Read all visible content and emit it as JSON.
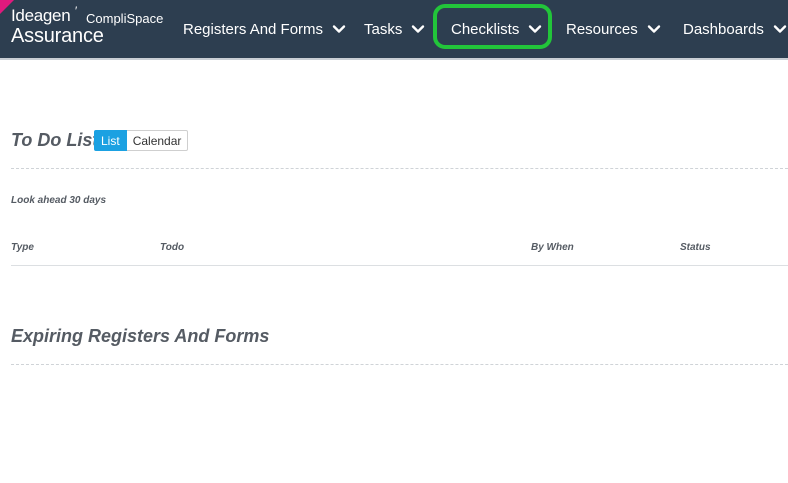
{
  "header": {
    "brand": "Ideagen",
    "product": "CompliSpace",
    "sub": "Assurance",
    "nav": [
      {
        "label": "Registers And Forms"
      },
      {
        "label": "Tasks"
      },
      {
        "label": "Checklists"
      },
      {
        "label": "Resources"
      },
      {
        "label": "Dashboards"
      }
    ]
  },
  "todo": {
    "title": "To Do List",
    "view_list": "List",
    "view_calendar": "Calendar",
    "lookahead": "Look ahead 30 days",
    "columns": {
      "type": "Type",
      "todo": "Todo",
      "by_when": "By When",
      "status": "Status"
    }
  },
  "expiring": {
    "title": "Expiring Registers And Forms"
  },
  "colors": {
    "header_bg": "#2d3e50",
    "highlight": "#22c53a",
    "active_toggle": "#1ba1e2",
    "corner": "#e0197d"
  }
}
